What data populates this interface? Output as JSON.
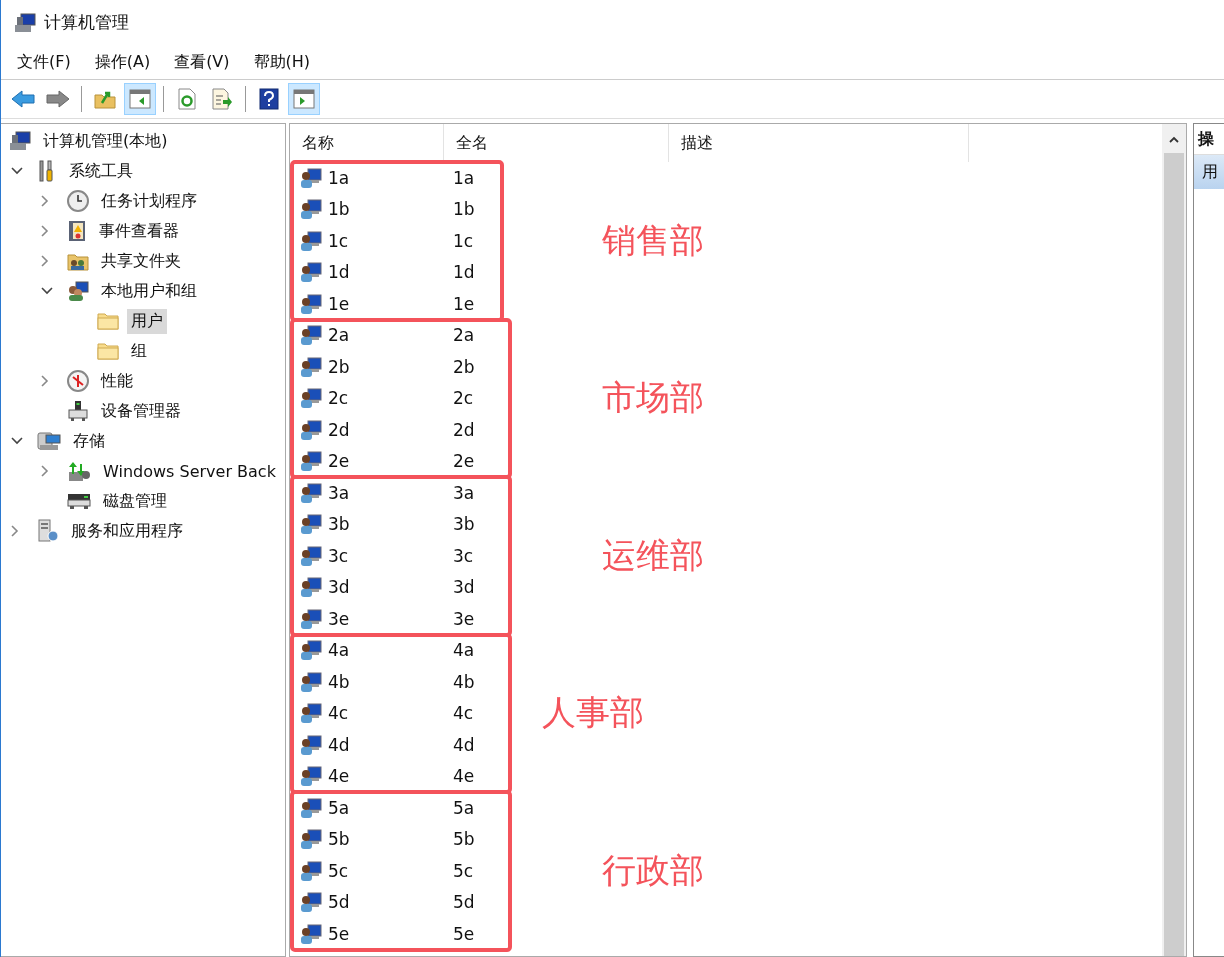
{
  "window": {
    "title": "计算机管理"
  },
  "menu": [
    "文件(F)",
    "操作(A)",
    "查看(V)",
    "帮助(H)"
  ],
  "toolbar": [
    {
      "kind": "back",
      "pressed": false
    },
    {
      "kind": "forward",
      "pressed": false
    },
    {
      "kind": "separator"
    },
    {
      "kind": "up",
      "pressed": false
    },
    {
      "kind": "tree-toggle",
      "pressed": true
    },
    {
      "kind": "separator"
    },
    {
      "kind": "refresh",
      "pressed": false
    },
    {
      "kind": "export",
      "pressed": false
    },
    {
      "kind": "separator"
    },
    {
      "kind": "help",
      "pressed": false
    },
    {
      "kind": "action-toggle",
      "pressed": true
    }
  ],
  "tree": [
    {
      "label": "计算机管理(本地)",
      "kind": "computer",
      "selected": false,
      "children": [
        {
          "label": "系统工具",
          "kind": "tools",
          "expanded": true,
          "selected": false,
          "children": [
            {
              "label": "任务计划程序",
              "kind": "clock",
              "expanded": false,
              "selected": false
            },
            {
              "label": "事件查看器",
              "kind": "log",
              "expanded": false,
              "selected": false
            },
            {
              "label": "共享文件夹",
              "kind": "share",
              "expanded": false,
              "selected": false
            },
            {
              "label": "本地用户和组",
              "kind": "users",
              "expanded": true,
              "selected": false,
              "children": [
                {
                  "label": "用户",
                  "kind": "folder",
                  "selected": true
                },
                {
                  "label": "组",
                  "kind": "folder",
                  "selected": false
                }
              ]
            },
            {
              "label": "性能",
              "kind": "gauge",
              "expanded": false,
              "selected": false
            },
            {
              "label": "设备管理器",
              "kind": "device",
              "selected": false
            }
          ]
        },
        {
          "label": "存储",
          "kind": "storage",
          "expanded": true,
          "selected": false,
          "children": [
            {
              "label": "Windows Server Back",
              "kind": "backup",
              "expanded": false,
              "selected": false
            },
            {
              "label": "磁盘管理",
              "kind": "disk",
              "selected": false
            }
          ]
        },
        {
          "label": "服务和应用程序",
          "kind": "services",
          "expanded": false,
          "selected": false
        }
      ]
    }
  ],
  "columns": [
    "名称",
    "全名",
    "描述"
  ],
  "groups": [
    {
      "label": "销售部",
      "color": "#f4535b",
      "rows": [
        {
          "name": "1a",
          "full_name": "1a"
        },
        {
          "name": "1b",
          "full_name": "1b"
        },
        {
          "name": "1c",
          "full_name": "1c"
        },
        {
          "name": "1d",
          "full_name": "1d"
        },
        {
          "name": "1e",
          "full_name": "1e"
        }
      ]
    },
    {
      "label": "市场部",
      "color": "#f4535b",
      "rows": [
        {
          "name": "2a",
          "full_name": "2a"
        },
        {
          "name": "2b",
          "full_name": "2b"
        },
        {
          "name": "2c",
          "full_name": "2c"
        },
        {
          "name": "2d",
          "full_name": "2d"
        },
        {
          "name": "2e",
          "full_name": "2e"
        }
      ]
    },
    {
      "label": "运维部",
      "color": "#f4535b",
      "rows": [
        {
          "name": "3a",
          "full_name": "3a"
        },
        {
          "name": "3b",
          "full_name": "3b"
        },
        {
          "name": "3c",
          "full_name": "3c"
        },
        {
          "name": "3d",
          "full_name": "3d"
        },
        {
          "name": "3e",
          "full_name": "3e"
        }
      ]
    },
    {
      "label": "人事部",
      "color": "#f4535b",
      "rows": [
        {
          "name": "4a",
          "full_name": "4a"
        },
        {
          "name": "4b",
          "full_name": "4b"
        },
        {
          "name": "4c",
          "full_name": "4c"
        },
        {
          "name": "4d",
          "full_name": "4d"
        },
        {
          "name": "4e",
          "full_name": "4e"
        }
      ]
    },
    {
      "label": "行政部",
      "color": "#f4535b",
      "rows": [
        {
          "name": "5a",
          "full_name": "5a"
        },
        {
          "name": "5b",
          "full_name": "5b"
        },
        {
          "name": "5c",
          "full_name": "5c"
        },
        {
          "name": "5d",
          "full_name": "5d"
        },
        {
          "name": "5e",
          "full_name": "5e"
        }
      ]
    }
  ],
  "actions": {
    "header": "操",
    "items": [
      {
        "label": "用",
        "selected": true
      }
    ]
  }
}
